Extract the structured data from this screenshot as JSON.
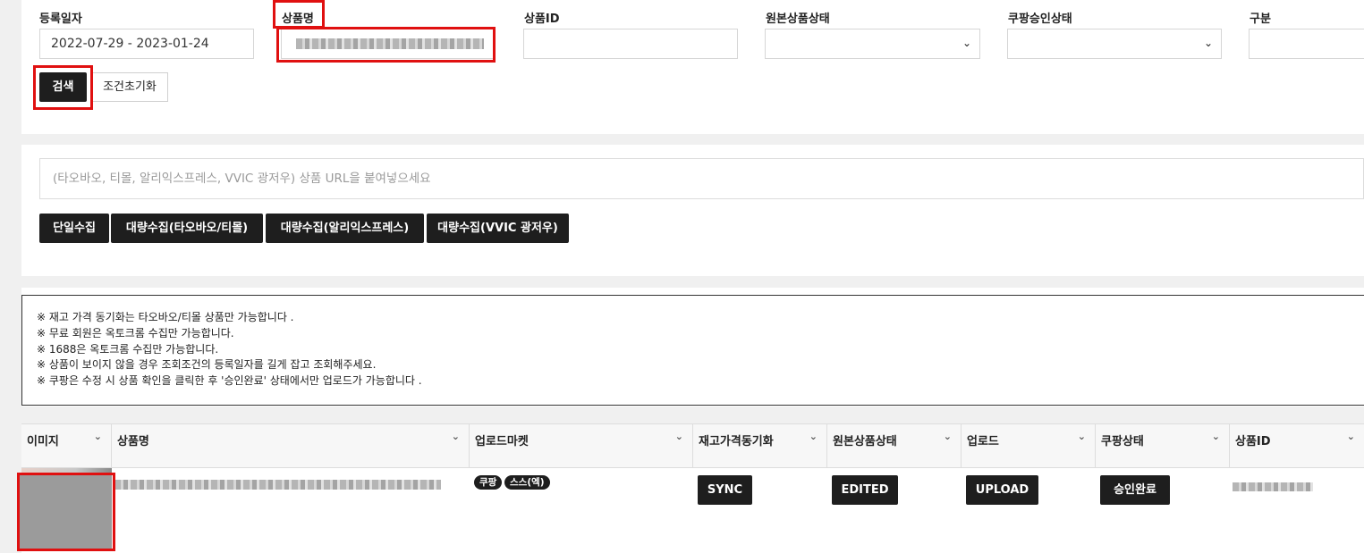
{
  "search": {
    "labels": {
      "reg_date": "등록일자",
      "product_name": "상품명",
      "product_id": "상품ID",
      "origin_status": "원본상품상태",
      "coupang_approval": "쿠팡승인상태",
      "category": "구분"
    },
    "reg_date_value": "2022-07-29 - 2023-01-24",
    "product_id_value": "",
    "search_button": "검색",
    "reset_button": "조건초기화"
  },
  "collect": {
    "url_placeholder": "(타오바오, 티몰, 알리익스프레스, VVIC 광저우) 상품 URL을 붙여넣으세요",
    "buttons": [
      "단일수집",
      "대량수집(타오바오/티몰)",
      "대량수집(알리익스프레스)",
      "대량수집(VVIC 광저우)"
    ]
  },
  "notice": {
    "lines": [
      "※ 재고 가격 동기화는 타오바오/티몰 상품만 가능합니다 .",
      "※ 무료 회원은 옥토크롬 수집만 가능합니다.",
      "※ 1688은 옥토크롬 수집만 가능합니다.",
      "※ 상품이 보이지 않을 경우 조회조건의 등록일자를 길게 잡고 조회해주세요.",
      "※ 쿠팡은 수정 시 상품 확인을 클릭한 후 '승인완료' 상태에서만 업로드가 가능합니다 ."
    ]
  },
  "grid": {
    "columns": [
      "이미지",
      "상품명",
      "업로드마켓",
      "재고가격동기화",
      "원본상품상태",
      "업로드",
      "쿠팡상태",
      "상품ID"
    ],
    "row": {
      "markets": [
        "쿠팡",
        "스스(엑)"
      ],
      "sync": "SYNC",
      "origin_status": "EDITED",
      "upload": "UPLOAD",
      "coupang_status": "승인완료"
    }
  },
  "icons": {
    "select_chevron": "chevron-down-icon",
    "sort_chevron": "chevron-down-icon"
  },
  "colors": {
    "highlight": "#e01010",
    "dark_button": "#1e1e1e"
  }
}
